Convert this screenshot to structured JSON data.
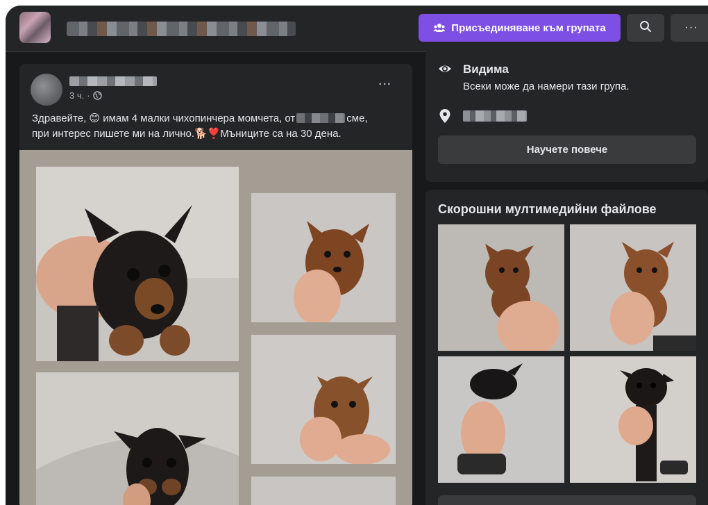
{
  "topbar": {
    "join_label": "Присъединяване към групата",
    "join_icon": "group-icon",
    "search_icon": "search-icon",
    "more_label": "···"
  },
  "post": {
    "time": "3 ч.",
    "separator": "·",
    "privacy_icon": "globe-icon",
    "more_label": "···",
    "text_line1_before": "Здравейте, 😊 имам 4 малки чихопинчера момчета, от",
    "text_line1_after": "сме,",
    "text_line2": "при интерес пишете ми на лично.🐕❣️Мъниците са на 30 дена."
  },
  "about": {
    "visibility_icon": "eye-icon",
    "visibility_title": "Видима",
    "visibility_desc": "Всеки може да намери тази група.",
    "location_icon": "location-pin-icon",
    "learn_more_label": "Научете повече"
  },
  "media": {
    "title": "Скорошни мултимедийни файлове"
  },
  "colors": {
    "background": "#18191a",
    "card": "#242526",
    "button": "#3a3b3c",
    "accent": "#7d4fe4",
    "text": "#e4e6eb",
    "muted": "#b0b3b8"
  }
}
